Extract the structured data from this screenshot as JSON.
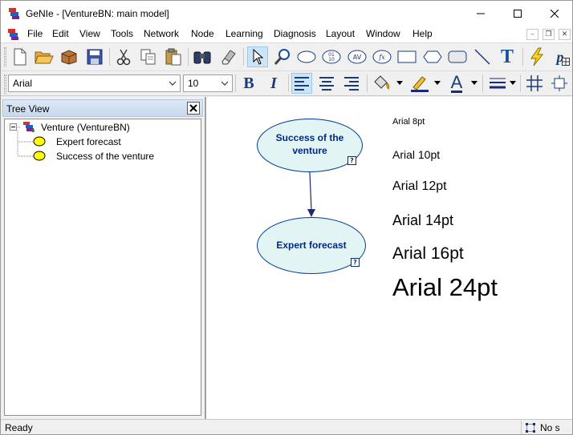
{
  "window": {
    "title": "GeNIe - [VentureBN: main model]"
  },
  "menu": {
    "items": [
      "File",
      "Edit",
      "View",
      "Tools",
      "Network",
      "Node",
      "Learning",
      "Diagnosis",
      "Layout",
      "Window",
      "Help"
    ]
  },
  "format_toolbar": {
    "font_family": "Arial",
    "font_size": "10",
    "bold_label": "B",
    "italic_label": "I",
    "font_color_label": "A"
  },
  "toolbar": {
    "text_tool_label": "T",
    "probability_label": "p"
  },
  "tree_view": {
    "title": "Tree View",
    "root_label": "Venture (VentureBN)",
    "nodes": [
      "Expert forecast",
      "Success of the venture"
    ]
  },
  "canvas": {
    "nodes": [
      {
        "line1": "Success of the",
        "line2": "venture",
        "badge": "?"
      },
      {
        "line1": "Expert forecast",
        "badge": "?"
      }
    ],
    "font_samples": [
      "Arial 8pt",
      "Arial 10pt",
      "Arial 12pt",
      "Arial 14pt",
      "Arial 16pt",
      "Arial 24pt"
    ]
  },
  "status": {
    "left": "Ready",
    "right": "No s"
  },
  "colors": {
    "node_fill": "#e3f4f4",
    "node_border": "#003d8f",
    "node_text": "#002a80",
    "tree_node_fill": "#ffff00"
  }
}
